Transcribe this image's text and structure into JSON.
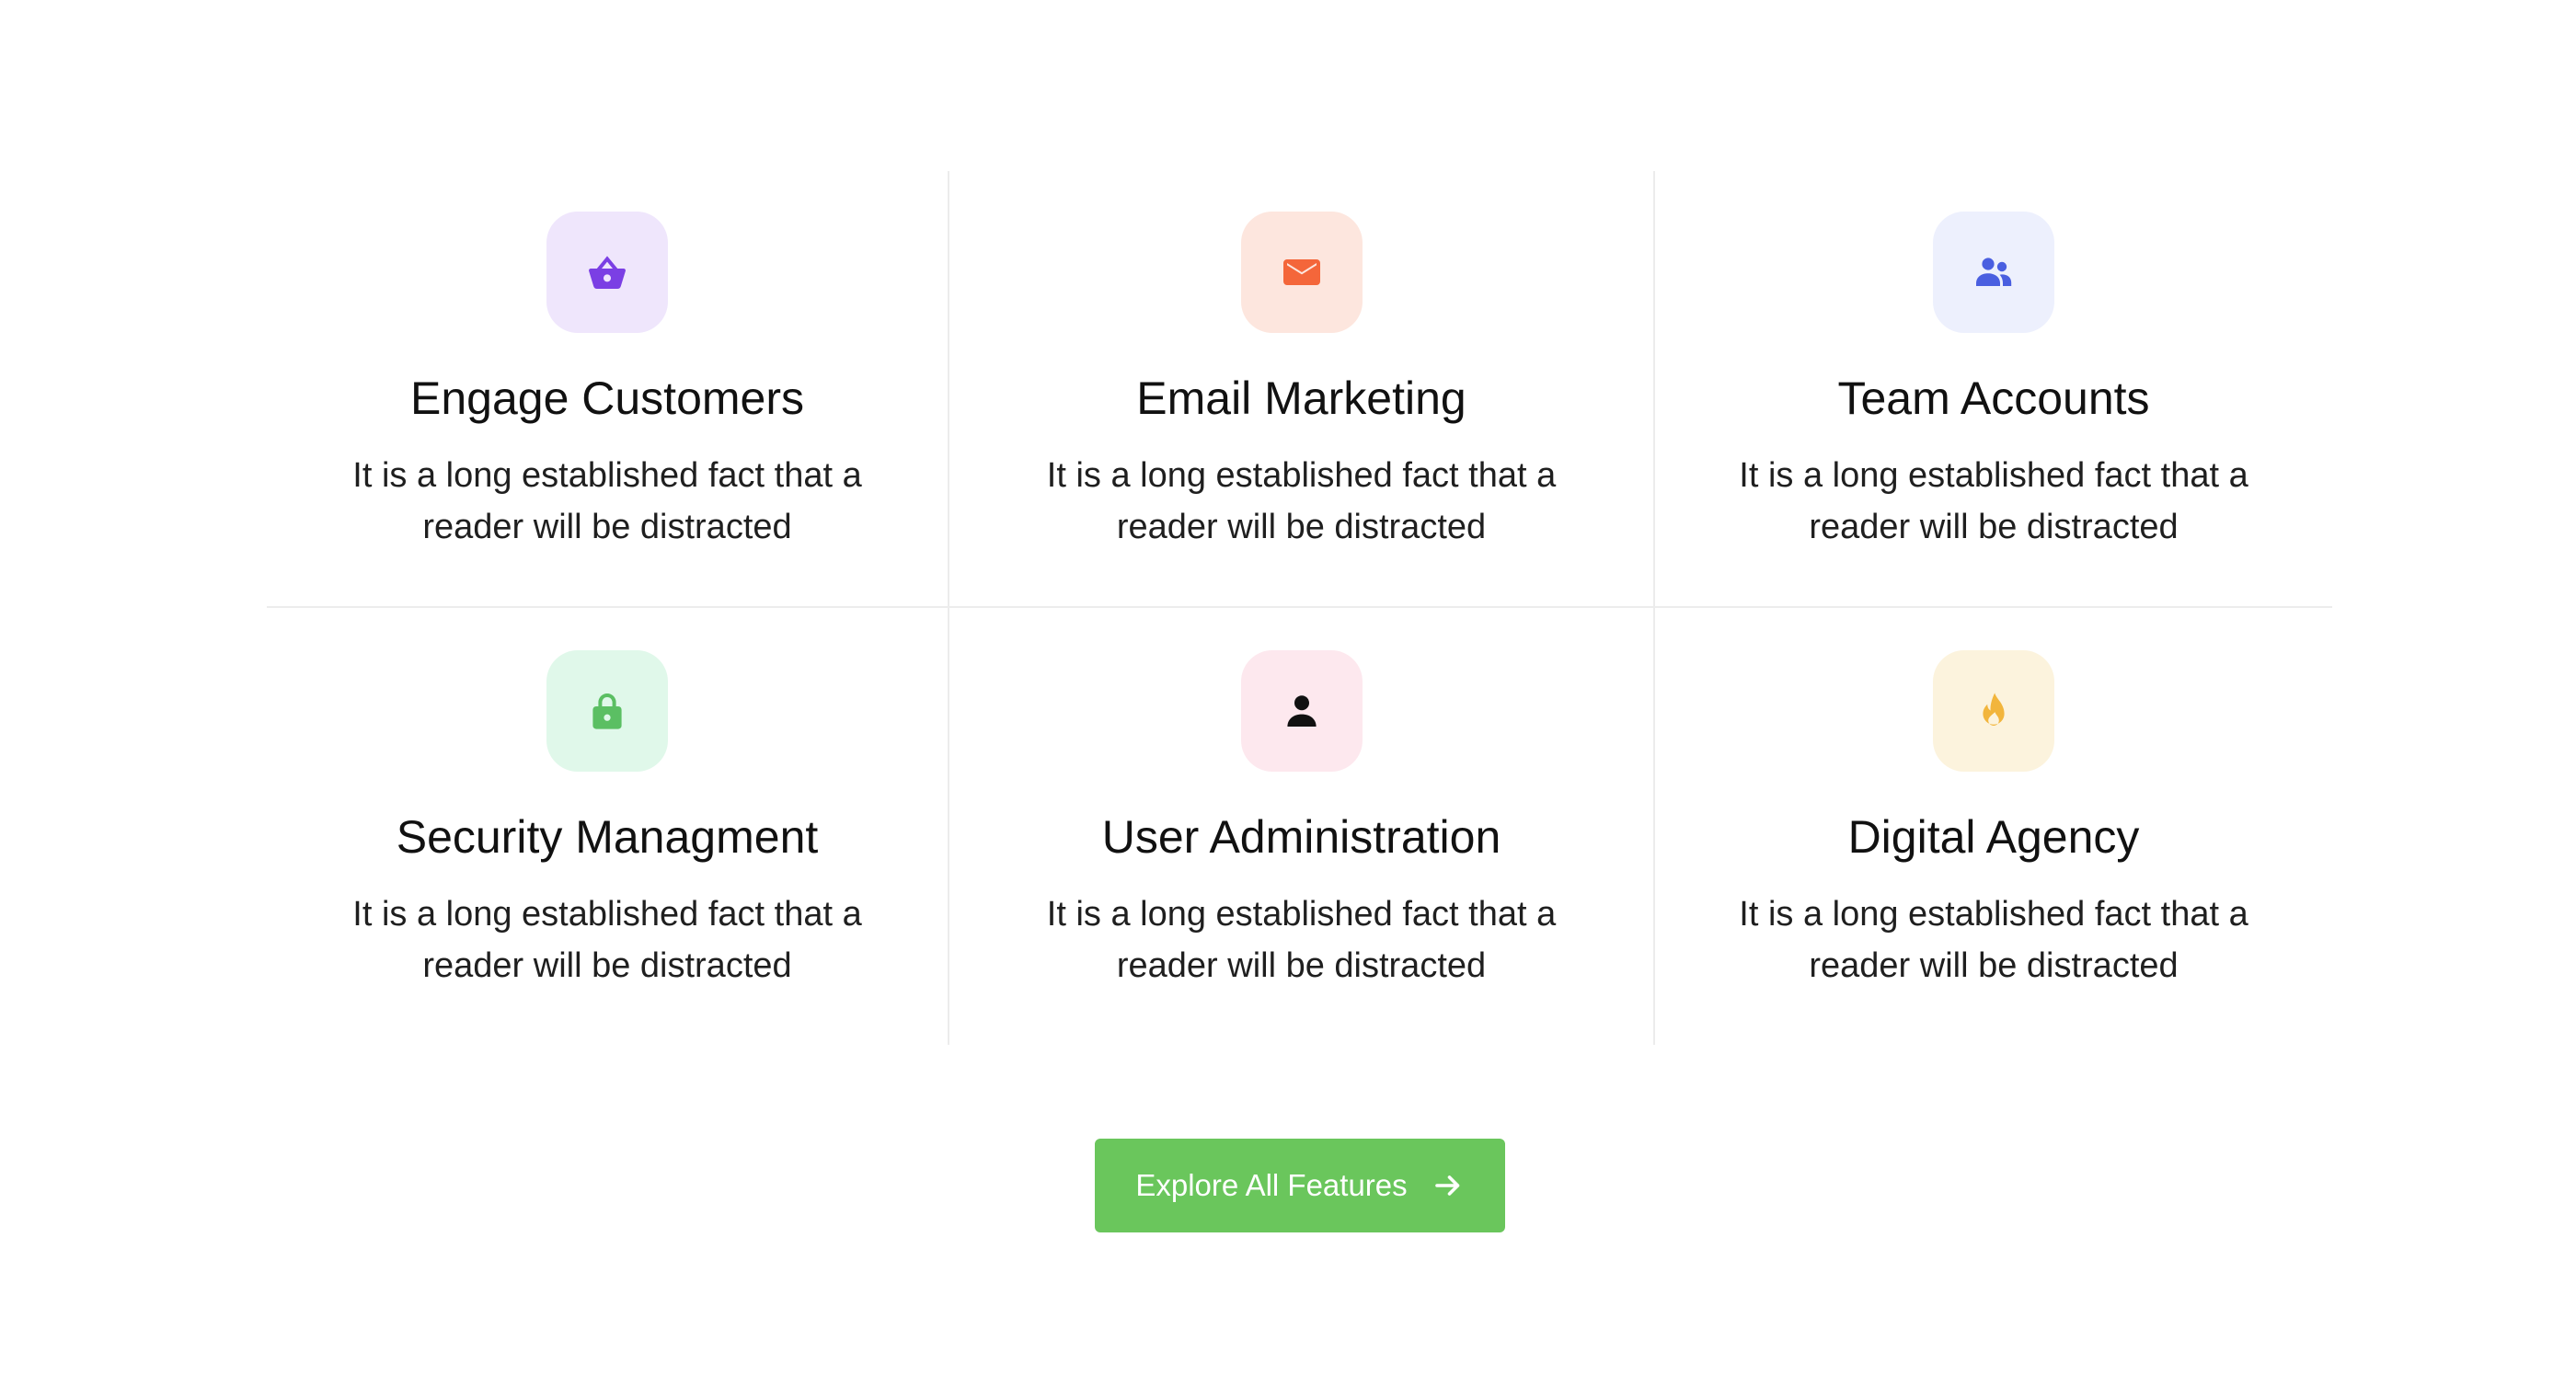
{
  "features": [
    {
      "title": "Engage Customers",
      "description": "It is a long established fact that a reader will be distracted",
      "icon": "basket-icon",
      "icon_color": "#7b3fe4",
      "tile_color": "#efe6fc"
    },
    {
      "title": "Email Marketing",
      "description": "It is a long established fact that a reader will be distracted",
      "icon": "mail-icon",
      "icon_color": "#f4663a",
      "tile_color": "#fde6de"
    },
    {
      "title": "Team Accounts",
      "description": "It is a long established fact that a reader will be distracted",
      "icon": "team-icon",
      "icon_color": "#4a5fe0",
      "tile_color": "#edf0fd"
    },
    {
      "title": "Security Managment",
      "description": "It is a long established fact that a reader will be distracted",
      "icon": "lock-icon",
      "icon_color": "#5bbf63",
      "tile_color": "#e0f8ea"
    },
    {
      "title": "User Administration",
      "description": "It is a long established fact that a reader will be distracted",
      "icon": "user-icon",
      "icon_color": "#111111",
      "tile_color": "#fde8ee"
    },
    {
      "title": "Digital Agency",
      "description": "It is a long established fact that a reader will be distracted",
      "icon": "flame-icon",
      "icon_color": "#f2b53c",
      "tile_color": "#fcf3dd"
    }
  ],
  "cta": {
    "label": "Explore All Features",
    "icon": "arrow-right-icon",
    "color": "#6ac65c",
    "text_color": "#ffffff"
  }
}
